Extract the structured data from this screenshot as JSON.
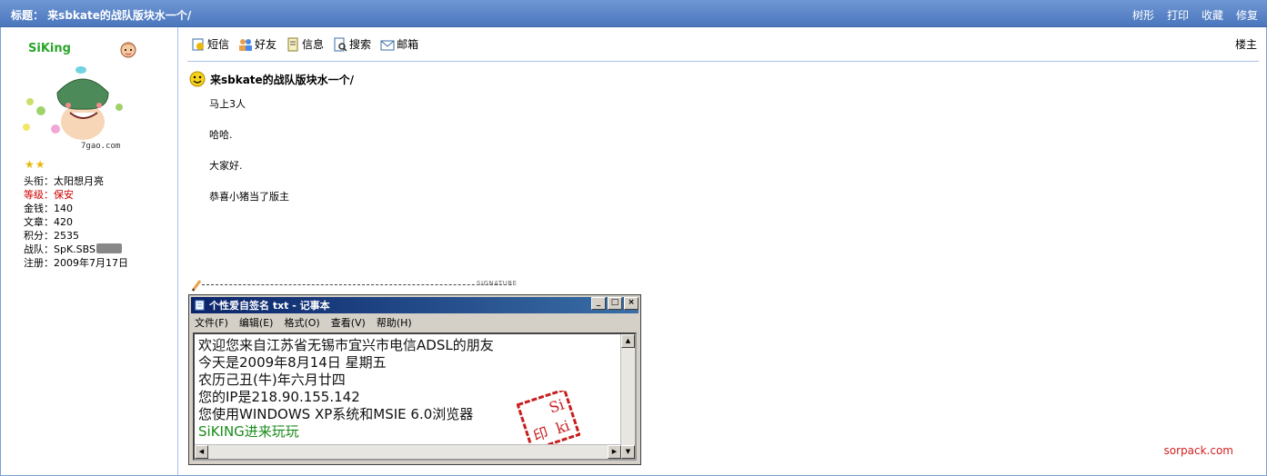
{
  "header": {
    "title": "标题： 来sbkate的战队版块水一个/",
    "actions": [
      "树形",
      "打印",
      "收藏",
      "修复"
    ]
  },
  "user": {
    "name": "SiKing",
    "avatar_caption": "7gao.com",
    "rank_stars": 2,
    "info": [
      {
        "label": "头衔：",
        "value": "太阳想月亮",
        "highlight": false
      },
      {
        "label": "等级：",
        "value": "保安",
        "highlight": true
      },
      {
        "label": "金钱：",
        "value": "140",
        "highlight": false
      },
      {
        "label": "文章：",
        "value": "420",
        "highlight": false
      },
      {
        "label": "积分：",
        "value": "2535",
        "highlight": false
      },
      {
        "label": "战队：",
        "value": "SpK.SBS",
        "highlight": false
      },
      {
        "label": "注册：",
        "value": "2009年7月17日",
        "highlight": false
      }
    ]
  },
  "toolbar": {
    "items": [
      {
        "label": "短信",
        "icon": "message-icon"
      },
      {
        "label": "好友",
        "icon": "friends-icon"
      },
      {
        "label": "信息",
        "icon": "info-icon"
      },
      {
        "label": "搜索",
        "icon": "search-icon"
      },
      {
        "label": "邮箱",
        "icon": "mail-icon"
      }
    ],
    "floor": "楼主"
  },
  "post": {
    "title": "来sbkate的战队版块水一个/",
    "lines": [
      "马上3人",
      "哈哈.",
      "大家好.",
      "恭喜小猪当了版主"
    ]
  },
  "signature": {
    "label": "SIGNATURE",
    "notepad": {
      "title": "个性爱自签名 txt - 记事本",
      "menu": [
        "文件(F)",
        "编辑(E)",
        "格式(O)",
        "查看(V)",
        "帮助(H)"
      ],
      "lines": [
        "欢迎您来自江苏省无锡市宜兴市电信ADSL的朋友",
        "今天是2009年8月14日 星期五",
        "农历己丑(牛)年六月廿四",
        "您的IP是218.90.155.142",
        "您使用WINDOWS XP系统和MSIE 6.0浏览器"
      ],
      "footer_line": "SiKING进来玩玩",
      "seal_text": [
        "Si",
        "印",
        "ki"
      ]
    }
  },
  "watermark": "sorpack.com",
  "colors": {
    "header_bg": "#5a84c8",
    "accent_red": "#cc0000",
    "username_green": "#2aa52a"
  }
}
